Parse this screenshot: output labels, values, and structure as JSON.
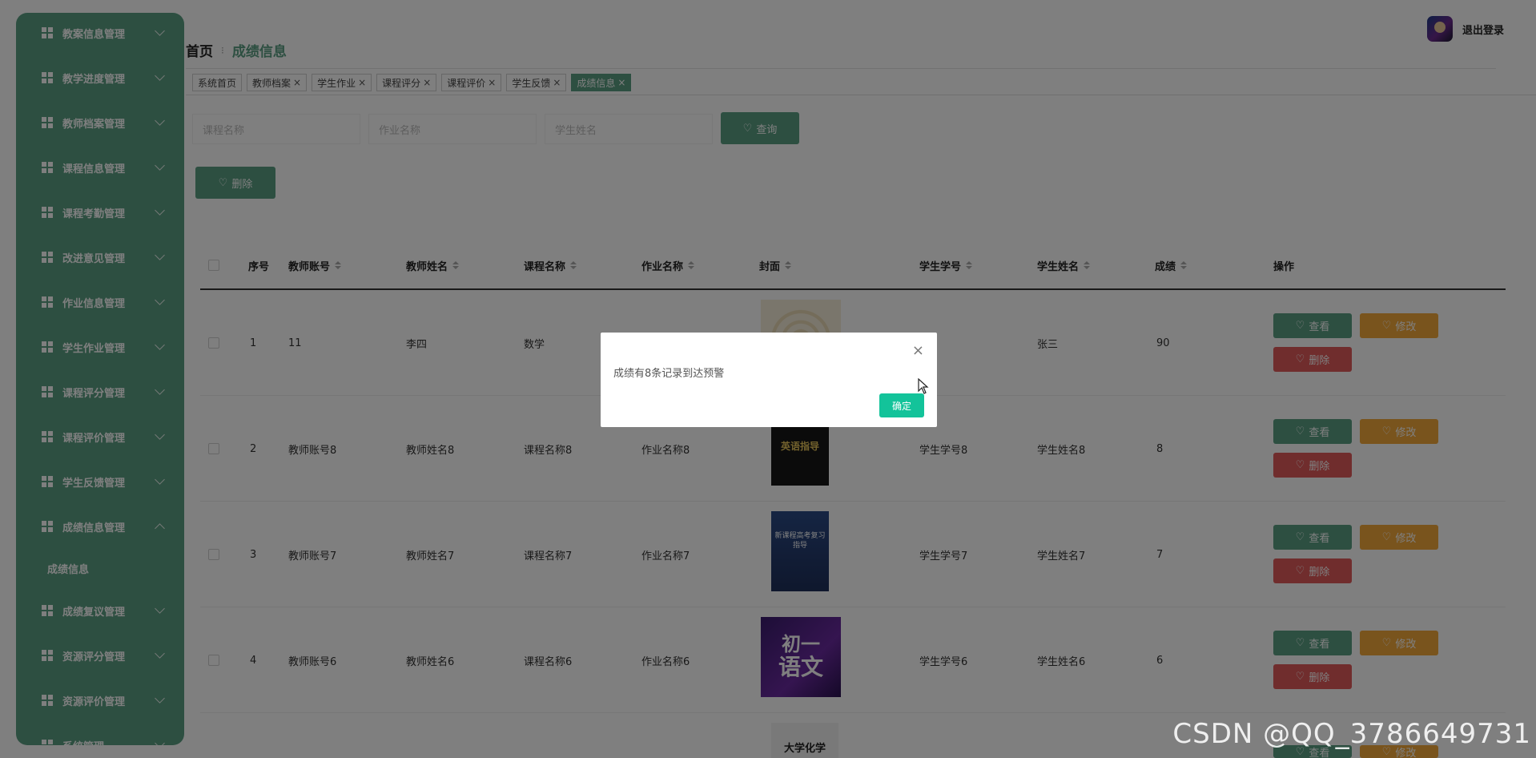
{
  "sidebar": {
    "items": [
      {
        "label": "教案信息管理",
        "icon": "grid-icon",
        "expanded": false
      },
      {
        "label": "教学进度管理",
        "icon": "grid-icon",
        "expanded": false
      },
      {
        "label": "教师档案管理",
        "icon": "grid-icon",
        "expanded": false
      },
      {
        "label": "课程信息管理",
        "icon": "chart-icon",
        "expanded": false
      },
      {
        "label": "课程考勤管理",
        "icon": "table-icon",
        "expanded": false
      },
      {
        "label": "改进意见管理",
        "icon": "grid-icon",
        "expanded": false
      },
      {
        "label": "作业信息管理",
        "icon": "briefcase-icon",
        "expanded": false
      },
      {
        "label": "学生作业管理",
        "icon": "thumb-icon",
        "expanded": false
      },
      {
        "label": "课程评分管理",
        "icon": "grid-icon",
        "expanded": false
      },
      {
        "label": "课程评价管理",
        "icon": "grid-icon",
        "expanded": false
      },
      {
        "label": "学生反馈管理",
        "icon": "clipboard-icon",
        "expanded": false
      },
      {
        "label": "成绩信息管理",
        "icon": "grid-icon",
        "expanded": true
      },
      {
        "label": "成绩复议管理",
        "icon": "grid-icon",
        "expanded": false
      },
      {
        "label": "资源评分管理",
        "icon": "list-icon",
        "expanded": false
      },
      {
        "label": "资源评价管理",
        "icon": "send-icon",
        "expanded": false
      },
      {
        "label": "系统管理",
        "icon": "monitor-icon",
        "expanded": false
      }
    ],
    "submenu": {
      "label": "成绩信息"
    }
  },
  "header": {
    "breadcrumb_home": "首页",
    "breadcrumb_sep": "⁝",
    "breadcrumb_current": "成绩信息",
    "logout": "退出登录"
  },
  "tags": [
    {
      "label": "系统首页",
      "closable": false,
      "active": false
    },
    {
      "label": "教师档案",
      "closable": true,
      "active": false
    },
    {
      "label": "学生作业",
      "closable": true,
      "active": false
    },
    {
      "label": "课程评分",
      "closable": true,
      "active": false
    },
    {
      "label": "课程评价",
      "closable": true,
      "active": false
    },
    {
      "label": "学生反馈",
      "closable": true,
      "active": false
    },
    {
      "label": "成绩信息",
      "closable": true,
      "active": true
    }
  ],
  "search": {
    "course_placeholder": "课程名称",
    "homework_placeholder": "作业名称",
    "student_placeholder": "学生姓名",
    "query_label": "查询",
    "delete_label": "删除"
  },
  "table": {
    "columns": [
      "序号",
      "教师账号",
      "教师姓名",
      "课程名称",
      "作业名称",
      "封面",
      "学生学号",
      "学生姓名",
      "成绩",
      "操作"
    ],
    "rows": [
      {
        "index": "1",
        "teacher_id": "11",
        "teacher_name": "李四",
        "course": "数学",
        "homework": "",
        "student_id": "",
        "student_name": "张三",
        "score": "90",
        "cover": "cover-spiral"
      },
      {
        "index": "2",
        "teacher_id": "教师账号8",
        "teacher_name": "教师姓名8",
        "course": "课程名称8",
        "homework": "作业名称8",
        "student_id": "学生学号8",
        "student_name": "学生姓名8",
        "score": "8",
        "cover": "cover-dark-book",
        "cover_text": "英语指导"
      },
      {
        "index": "3",
        "teacher_id": "教师账号7",
        "teacher_name": "教师姓名7",
        "course": "课程名称7",
        "homework": "作业名称7",
        "student_id": "学生学号7",
        "student_name": "学生姓名7",
        "score": "7",
        "cover": "cover-blue-book",
        "cover_text": "新课程高考复习指导"
      },
      {
        "index": "4",
        "teacher_id": "教师账号6",
        "teacher_name": "教师姓名6",
        "course": "课程名称6",
        "homework": "作业名称6",
        "student_id": "学生学号6",
        "student_name": "学生姓名6",
        "score": "6",
        "cover": "cover-chinese",
        "cover_text_1": "初一",
        "cover_text_2": "语文"
      },
      {
        "index": "",
        "teacher_id": "",
        "teacher_name": "",
        "course": "",
        "homework": "",
        "student_id": "",
        "student_name": "",
        "score": "",
        "cover": "cover-chemistry",
        "cover_text": "大学化学"
      }
    ],
    "actions": {
      "view": "查看",
      "edit": "修改",
      "delete": "删除"
    }
  },
  "dialog": {
    "message": "成绩有8条记录到达预警",
    "ok": "确定",
    "close": "×"
  },
  "watermark": "CSDN @QQ_3786649731",
  "colors": {
    "primary": "#5a9e83",
    "edit": "#f3a83b",
    "danger": "#e05a5a",
    "confirm": "#13c39a"
  }
}
